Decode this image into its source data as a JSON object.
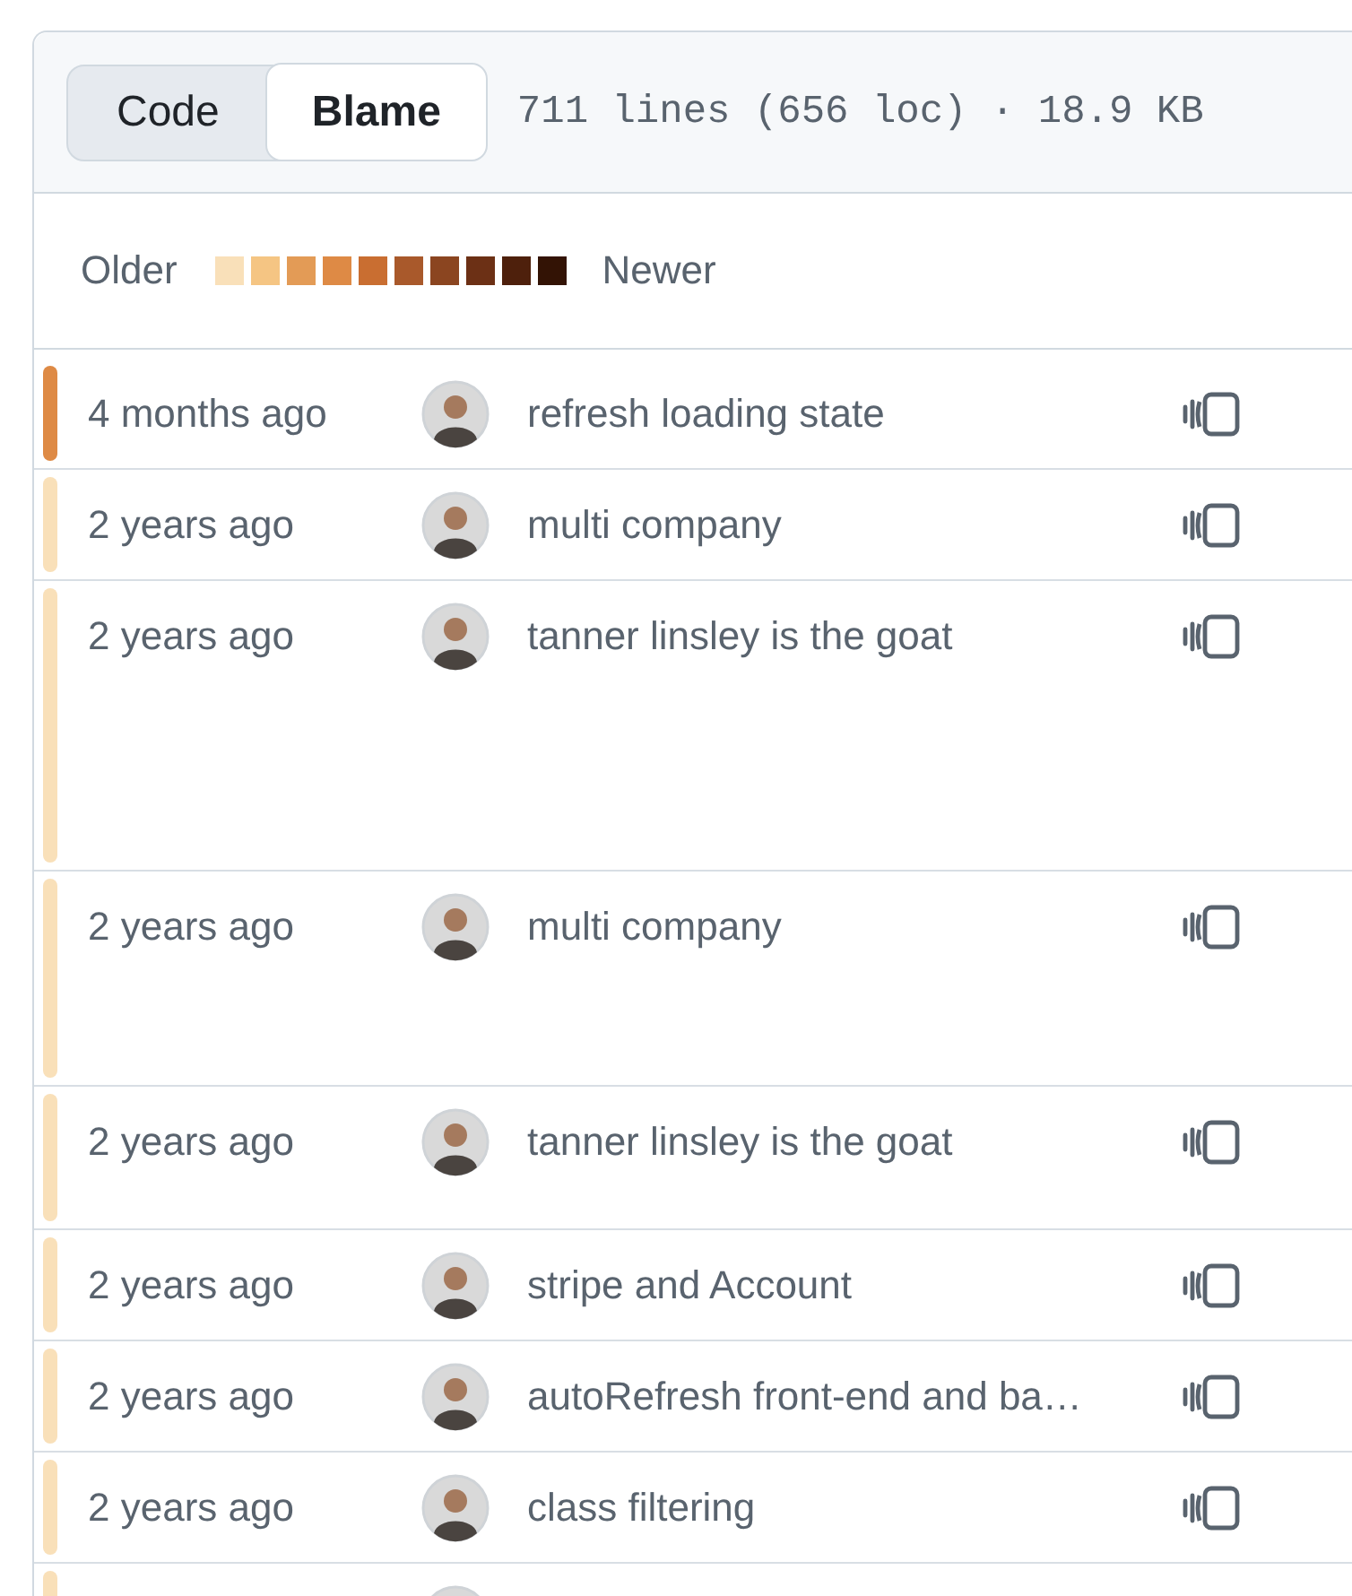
{
  "view_toggle": [
    {
      "label": "Code",
      "selected": false
    },
    {
      "label": "Blame",
      "selected": true
    }
  ],
  "file_info": "711 lines (656 loc) · 18.9 KB",
  "legend": {
    "older": "Older",
    "newer": "Newer"
  },
  "rows": [
    {
      "color": "#de8a45",
      "age": "4 months ago",
      "message": "refresh loading state"
    },
    {
      "color": "#f9e0b9",
      "age": "2 years ago",
      "message": "multi company"
    },
    {
      "color": "#f9e0b9",
      "age": "2 years ago",
      "message": "tanner linsley is the goat"
    },
    {
      "color": "#f9e0b9",
      "age": "2 years ago",
      "message": "multi company"
    },
    {
      "color": "#f9e0b9",
      "age": "2 years ago",
      "message": "tanner linsley is the goat"
    },
    {
      "color": "#f9e0b9",
      "age": "2 years ago",
      "message": "stripe and Account"
    },
    {
      "color": "#f9e0b9",
      "age": "2 years ago",
      "message": "autoRefresh front-end and ba…"
    },
    {
      "color": "#f9e0b9",
      "age": "2 years ago",
      "message": "class filtering"
    },
    {
      "color": "#f9e0b9"
    }
  ]
}
